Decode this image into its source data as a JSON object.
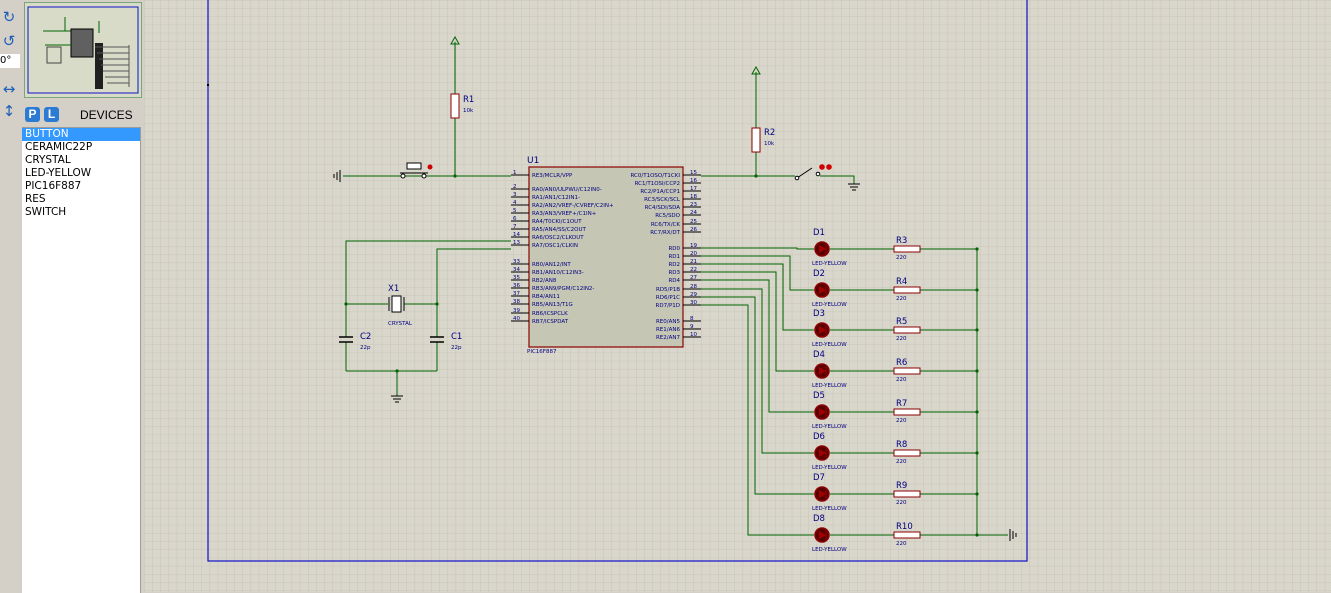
{
  "toolbar": {
    "tools": [
      {
        "name": "rotate-clockwise-icon",
        "glyph": "↻"
      },
      {
        "name": "rotate-anticlockwise-icon",
        "glyph": "↺"
      },
      {
        "name": "mirror-horizontal-icon",
        "glyph": "↔"
      },
      {
        "name": "mirror-vertical-icon",
        "glyph": "↕"
      }
    ],
    "angle": "0°"
  },
  "devices_panel": {
    "pick_label": "P",
    "library_label": "L",
    "title": "DEVICES",
    "items": [
      "BUTTON",
      "CERAMIC22P",
      "CRYSTAL",
      "LED-YELLOW",
      "PIC16F887",
      "RES",
      "SWITCH"
    ],
    "selected": "BUTTON"
  },
  "schematic": {
    "colors": {
      "wire": "#006400",
      "component": "#8b0000",
      "body_fill": "#c6c6b5",
      "text": "#000080",
      "sheet_border": "#1010c8",
      "grid": "#c5c1b4",
      "background": "#d9d6cb"
    },
    "u1": {
      "ref": "U1",
      "part": "PIC16F887",
      "left_pins": [
        {
          "num": "1",
          "name": "RE3/MCLR/VPP"
        },
        {
          "num": "2",
          "name": "RA0/AN0/ULPWU/C12IN0-"
        },
        {
          "num": "3",
          "name": "RA1/AN1/C12IN1-"
        },
        {
          "num": "4",
          "name": "RA2/AN2/VREF-/CVREF/C2IN+"
        },
        {
          "num": "5",
          "name": "RA3/AN3/VREF+/C1IN+"
        },
        {
          "num": "6",
          "name": "RA4/T0CKI/C1OUT"
        },
        {
          "num": "7",
          "name": "RA5/AN4/SS/C2OUT"
        },
        {
          "num": "14",
          "name": "RA6/OSC2/CLKOUT"
        },
        {
          "num": "13",
          "name": "RA7/OSC1/CLKIN"
        },
        {
          "num": "33",
          "name": "RB0/AN12/INT"
        },
        {
          "num": "34",
          "name": "RB1/AN10/C12IN3-"
        },
        {
          "num": "35",
          "name": "RB2/AN8"
        },
        {
          "num": "36",
          "name": "RB3/AN9/PGM/C12IN2-"
        },
        {
          "num": "37",
          "name": "RB4/AN11"
        },
        {
          "num": "38",
          "name": "RB5/AN13/T1G"
        },
        {
          "num": "39",
          "name": "RB6/ICSPCLK"
        },
        {
          "num": "40",
          "name": "RB7/ICSPDAT"
        }
      ],
      "right_pins": [
        {
          "num": "15",
          "name": "RC0/T1OSO/T1CKI"
        },
        {
          "num": "16",
          "name": "RC1/T1OSI/CCP2"
        },
        {
          "num": "17",
          "name": "RC2/P1A/CCP1"
        },
        {
          "num": "18",
          "name": "RC3/SCK/SCL"
        },
        {
          "num": "23",
          "name": "RC4/SDI/SDA"
        },
        {
          "num": "24",
          "name": "RC5/SDO"
        },
        {
          "num": "25",
          "name": "RC6/TX/CK"
        },
        {
          "num": "26",
          "name": "RC7/RX/DT"
        },
        {
          "num": "19",
          "name": "RD0"
        },
        {
          "num": "20",
          "name": "RD1"
        },
        {
          "num": "21",
          "name": "RD2"
        },
        {
          "num": "22",
          "name": "RD3"
        },
        {
          "num": "27",
          "name": "RD4"
        },
        {
          "num": "28",
          "name": "RD5/P1B"
        },
        {
          "num": "29",
          "name": "RD6/P1C"
        },
        {
          "num": "30",
          "name": "RD7/P1D"
        },
        {
          "num": "8",
          "name": "RE0/AN5"
        },
        {
          "num": "9",
          "name": "RE1/AN6"
        },
        {
          "num": "10",
          "name": "RE2/AN7"
        }
      ]
    },
    "r1": {
      "ref": "R1",
      "value": "10k"
    },
    "r2": {
      "ref": "R2",
      "value": "10k"
    },
    "x1": {
      "ref": "X1",
      "value": "CRYSTAL"
    },
    "c1": {
      "ref": "C1",
      "value": "22p"
    },
    "c2": {
      "ref": "C2",
      "value": "22p"
    },
    "leds": [
      {
        "ref": "D1",
        "value": "LED-YELLOW",
        "res_ref": "R3",
        "res_value": "220"
      },
      {
        "ref": "D2",
        "value": "LED-YELLOW",
        "res_ref": "R4",
        "res_value": "220"
      },
      {
        "ref": "D3",
        "value": "LED-YELLOW",
        "res_ref": "R5",
        "res_value": "220"
      },
      {
        "ref": "D4",
        "value": "LED-YELLOW",
        "res_ref": "R6",
        "res_value": "220"
      },
      {
        "ref": "D5",
        "value": "LED-YELLOW",
        "res_ref": "R7",
        "res_value": "220"
      },
      {
        "ref": "D6",
        "value": "LED-YELLOW",
        "res_ref": "R8",
        "res_value": "220"
      },
      {
        "ref": "D7",
        "value": "LED-YELLOW",
        "res_ref": "R9",
        "res_value": "220"
      },
      {
        "ref": "D8",
        "value": "LED-YELLOW",
        "res_ref": "R10",
        "res_value": "220"
      }
    ]
  }
}
